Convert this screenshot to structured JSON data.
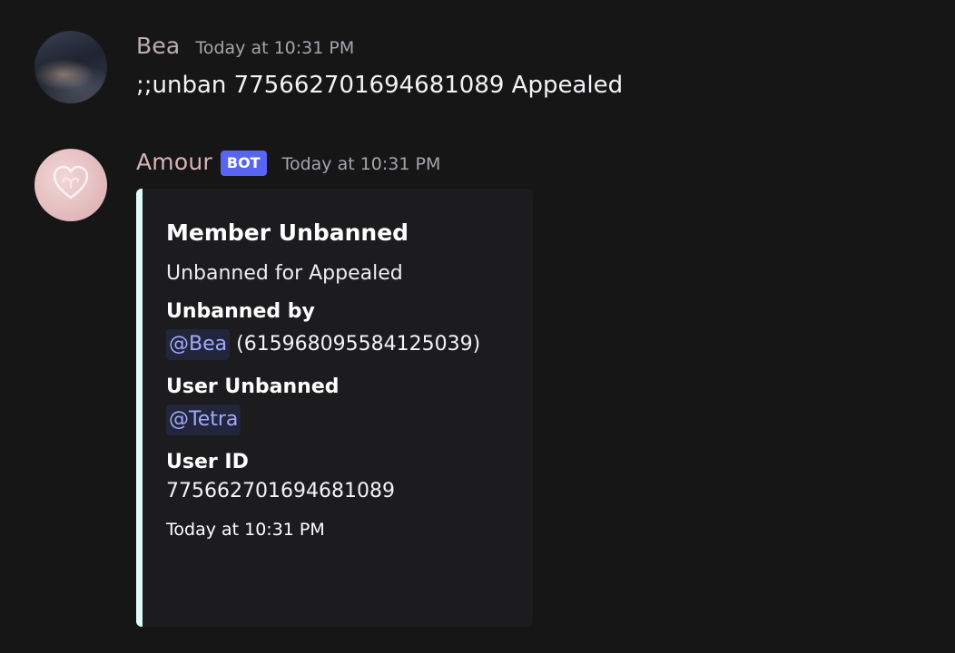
{
  "messages": [
    {
      "author": "Bea",
      "timestamp": "Today at 10:31 PM",
      "content": ";;unban 775662701694681089 Appealed",
      "avatar_icon": "user-avatar-photo"
    },
    {
      "author": "Amour",
      "bot_tag": "BOT",
      "timestamp": "Today at 10:31 PM",
      "avatar_icon": "heart-avatar",
      "embed": {
        "accent_color": "#ddfbfa",
        "title": "Member Unbanned",
        "description": "Unbanned for Appealed",
        "fields": [
          {
            "name": "Unbanned by",
            "mention": "@Bea",
            "value": "(615968095584125039)"
          },
          {
            "name": "User Unbanned",
            "mention": "@Tetra"
          },
          {
            "name": "User ID",
            "value": "775662701694681089"
          }
        ],
        "footer": "Today at 10:31 PM"
      }
    }
  ],
  "colors": {
    "background": "#161617",
    "embed_background": "#1c1c1e",
    "bot_tag": "#5865f2",
    "mention_text": "#a2aaf8"
  }
}
